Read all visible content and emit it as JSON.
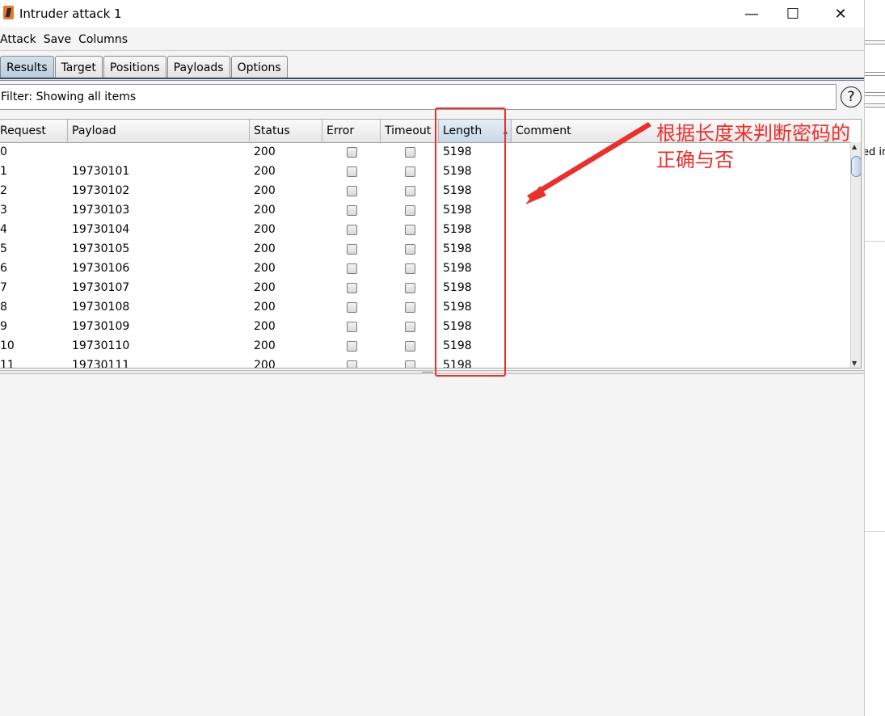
{
  "window": {
    "title": "Intruder attack 1",
    "controls": {
      "minimize": "—",
      "maximize": "☐",
      "close": "✕"
    }
  },
  "menu": [
    "Attack",
    "Save",
    "Columns"
  ],
  "tabs": [
    {
      "label": "Results",
      "active": true
    },
    {
      "label": "Target",
      "active": false
    },
    {
      "label": "Positions",
      "active": false
    },
    {
      "label": "Payloads",
      "active": false
    },
    {
      "label": "Options",
      "active": false
    }
  ],
  "filter": {
    "text": "Filter: Showing all items",
    "help": "?"
  },
  "table": {
    "columns": [
      "Request",
      "Payload",
      "Status",
      "Error",
      "Timeout",
      "Length",
      "Comment"
    ],
    "sorted_column": "Length",
    "rows": [
      {
        "request": "0",
        "payload": "",
        "status": "200",
        "error": false,
        "timeout": false,
        "length": "5198",
        "comment": ""
      },
      {
        "request": "1",
        "payload": "19730101",
        "status": "200",
        "error": false,
        "timeout": false,
        "length": "5198",
        "comment": ""
      },
      {
        "request": "2",
        "payload": "19730102",
        "status": "200",
        "error": false,
        "timeout": false,
        "length": "5198",
        "comment": ""
      },
      {
        "request": "3",
        "payload": "19730103",
        "status": "200",
        "error": false,
        "timeout": false,
        "length": "5198",
        "comment": ""
      },
      {
        "request": "4",
        "payload": "19730104",
        "status": "200",
        "error": false,
        "timeout": false,
        "length": "5198",
        "comment": ""
      },
      {
        "request": "5",
        "payload": "19730105",
        "status": "200",
        "error": false,
        "timeout": false,
        "length": "5198",
        "comment": ""
      },
      {
        "request": "6",
        "payload": "19730106",
        "status": "200",
        "error": false,
        "timeout": false,
        "length": "5198",
        "comment": ""
      },
      {
        "request": "7",
        "payload": "19730107",
        "status": "200",
        "error": false,
        "timeout": false,
        "length": "5198",
        "comment": ""
      },
      {
        "request": "8",
        "payload": "19730108",
        "status": "200",
        "error": false,
        "timeout": false,
        "length": "5198",
        "comment": ""
      },
      {
        "request": "9",
        "payload": "19730109",
        "status": "200",
        "error": false,
        "timeout": false,
        "length": "5198",
        "comment": ""
      },
      {
        "request": "10",
        "payload": "19730110",
        "status": "200",
        "error": false,
        "timeout": false,
        "length": "5198",
        "comment": ""
      },
      {
        "request": "11",
        "payload": "19730111",
        "status": "200",
        "error": false,
        "timeout": false,
        "length": "5198",
        "comment": ""
      }
    ]
  },
  "background_window": {
    "partial_text": "ed in"
  },
  "annotation": {
    "lines": [
      "根据长度来判断密码的",
      "正确与否"
    ],
    "color": "#e8302e"
  }
}
